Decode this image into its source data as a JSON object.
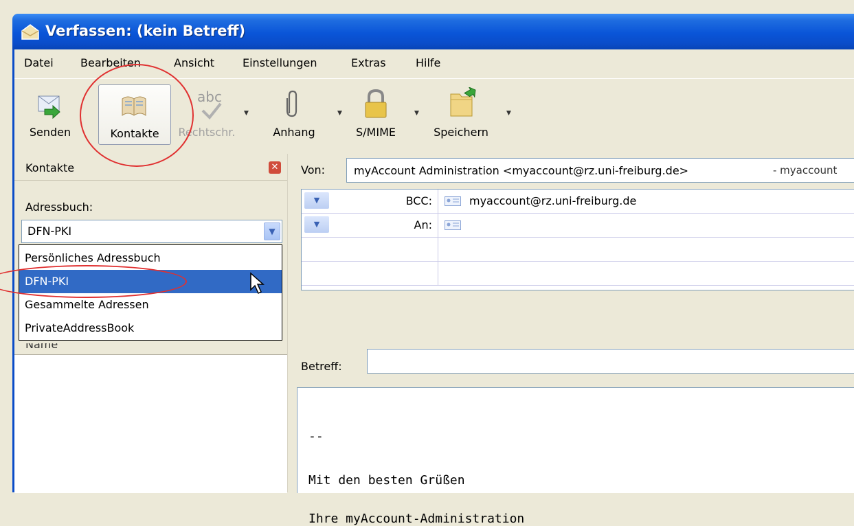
{
  "window": {
    "title": "Verfassen: (kein Betreff)"
  },
  "menu": [
    {
      "label": "Datei"
    },
    {
      "label": "Bearbeiten"
    },
    {
      "label": "Ansicht"
    },
    {
      "label": "Einstellungen"
    },
    {
      "label": "Extras"
    },
    {
      "label": "Hilfe"
    }
  ],
  "toolbar": {
    "send": "Senden",
    "contacts": "Kontakte",
    "spell": "Rechtschr.",
    "attach": "Anhang",
    "smime": "S/MIME",
    "save": "Speichern",
    "spell_icon_text": "abc"
  },
  "sidebar": {
    "title": "Kontakte",
    "addressbook_label": "Adressbuch:",
    "addressbook_value": "DFN-PKI",
    "options": [
      "Persönliches Adressbuch",
      "DFN-PKI",
      "Gesammelte Adressen",
      "PrivateAddressBook"
    ],
    "selected_index": 1,
    "list_header_peek": "Name"
  },
  "compose": {
    "from_label": "Von:",
    "from_value": "myAccount Administration <myaccount@rz.uni-freiburg.de>",
    "from_extra": "- myaccount",
    "recipients": [
      {
        "type": "BCC:",
        "address": "myaccount@rz.uni-freiburg.de"
      },
      {
        "type": "An:",
        "address": ""
      }
    ],
    "subject_label": "Betreff:",
    "subject_value": "",
    "body": [
      "--",
      "Mit den besten Grüßen",
      "Ihre myAccount-Administration"
    ]
  },
  "colors": {
    "titlebar": "#0a55d8",
    "selection": "#316ac5",
    "annotation": "#e03030"
  }
}
